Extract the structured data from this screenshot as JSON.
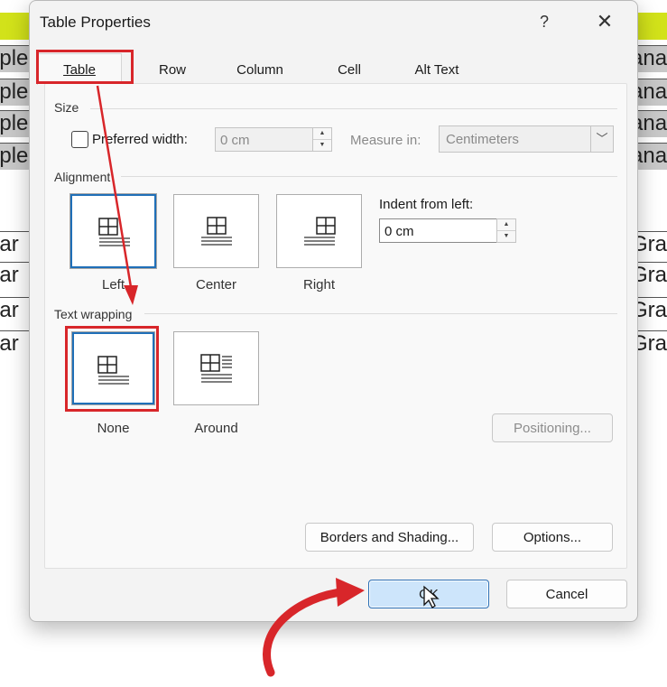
{
  "background_doc": {
    "rows_top": [
      "ople",
      "ople",
      "ople",
      "ople"
    ],
    "rows_top_right": [
      "ana",
      "ana",
      "ana",
      "ana"
    ],
    "rows_bottom": [
      "ear",
      "ear",
      "ear",
      "ear"
    ],
    "rows_bottom_right": [
      "Grap",
      "Grap",
      "Grap",
      "Grap"
    ]
  },
  "dialog": {
    "title": "Table Properties",
    "help_label": "?",
    "close_label": "✕"
  },
  "tabs": [
    {
      "label": "Table",
      "active": true
    },
    {
      "label": "Row",
      "active": false
    },
    {
      "label": "Column",
      "active": false
    },
    {
      "label": "Cell",
      "active": false
    },
    {
      "label": "Alt Text",
      "active": false
    }
  ],
  "size": {
    "group_label": "Size",
    "preferred_width_label": "Preferred width:",
    "preferred_width_checked": false,
    "width_value": "0 cm",
    "measure_in_label": "Measure in:",
    "measure_in_value": "Centimeters"
  },
  "alignment": {
    "group_label": "Alignment",
    "options": [
      {
        "label": "Left",
        "selected": true
      },
      {
        "label": "Center",
        "selected": false
      },
      {
        "label": "Right",
        "selected": false
      }
    ],
    "indent_label": "Indent from left:",
    "indent_value": "0 cm"
  },
  "text_wrapping": {
    "group_label": "Text wrapping",
    "options": [
      {
        "label": "None",
        "selected": true
      },
      {
        "label": "Around",
        "selected": false
      }
    ],
    "positioning_label": "Positioning..."
  },
  "buttons": {
    "borders_shading": "Borders and Shading...",
    "options": "Options...",
    "ok": "OK",
    "cancel": "Cancel"
  },
  "colors": {
    "annotation_red": "#d8262a",
    "selection_blue": "#1f6fb8",
    "band_yellow": "#d2e21a"
  }
}
